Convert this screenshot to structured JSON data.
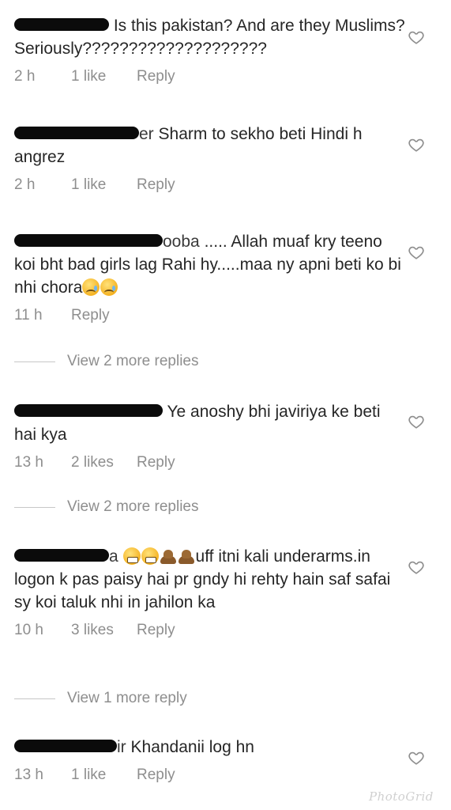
{
  "comments": [
    {
      "username_tail": "",
      "text": "Is this pakistan? And are they Muslims? Seriously????????????????????",
      "time": "2 h",
      "likes": "1 like",
      "reply": "Reply"
    },
    {
      "username_tail": "er",
      "text": "Sharm to sekho beti Hindi h angrez",
      "time": "2 h",
      "likes": "1 like",
      "reply": "Reply"
    },
    {
      "username_tail": "ooba",
      "text": "..... Allah muaf kry teeno koi bht bad girls lag Rahi hy.....maa ny apni beti ko bi nhi chora",
      "time": "11 h",
      "likes": "",
      "reply": "Reply"
    },
    {
      "username_tail": "",
      "text": "Ye anoshy bhi javiriya ke beti hai kya",
      "time": "13 h",
      "likes": "2 likes",
      "reply": "Reply"
    },
    {
      "username_tail": "a",
      "text": "uff itni kali underarms.in logon k pas paisy hai pr gndy hi rehty hain saf safai sy koi taluk nhi in jahilon ka",
      "time": "10 h",
      "likes": "3 likes",
      "reply": "Reply"
    },
    {
      "username_tail": "ir",
      "text": "Khandanii log hn",
      "time": "13 h",
      "likes": "1 like",
      "reply": "Reply"
    }
  ],
  "view_more": [
    "View 2 more replies",
    "View 2 more replies",
    "View 1 more reply"
  ],
  "icons": {
    "like": "heart-outline-icon",
    "emoji_sad": "sad-relieved-face-emoji",
    "emoji_grimace": "grimacing-face-emoji",
    "emoji_poo": "pile-of-poo-emoji"
  },
  "colors": {
    "text": "#262626",
    "meta": "#8e8e8e",
    "divider": "#c7c7c7",
    "redaction": "#0b0b0b"
  },
  "watermark": "PhotoGrid"
}
